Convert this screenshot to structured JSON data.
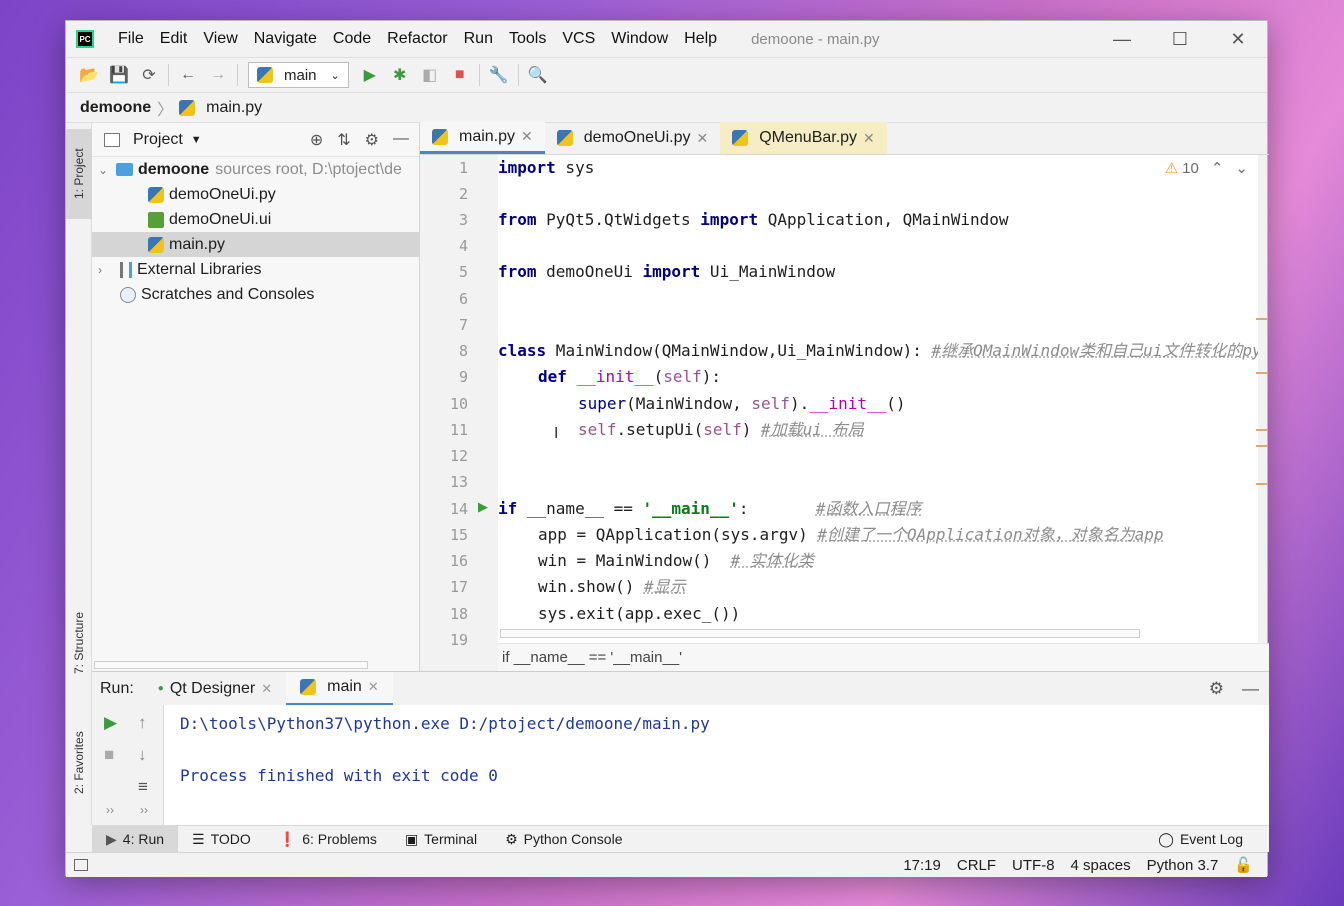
{
  "window": {
    "title": "demoone - main.py",
    "menu": [
      "File",
      "Edit",
      "View",
      "Navigate",
      "Code",
      "Refactor",
      "Run",
      "Tools",
      "VCS",
      "Window",
      "Help"
    ],
    "controls": [
      "—",
      "☐",
      "✕"
    ]
  },
  "toolbar": {
    "run_config": "main"
  },
  "breadcrumb": {
    "project": "demoone",
    "file": "main.py"
  },
  "left_stripe": {
    "project_tab": "1: Project",
    "structure_tab": "7: Structure",
    "favorites_tab": "2: Favorites"
  },
  "project_panel": {
    "title": "Project",
    "root_name": "demoone",
    "root_hint": "sources root,  D:\\ptoject\\de",
    "files": [
      "demoOneUi.py",
      "demoOneUi.ui",
      "main.py"
    ],
    "external_libraries": "External Libraries",
    "scratches": "Scratches and Consoles"
  },
  "editor": {
    "tabs": [
      "main.py",
      "demoOneUi.py",
      "QMenuBar.py"
    ],
    "warnings_count": "10",
    "line_numbers": [
      "1",
      "2",
      "3",
      "4",
      "5",
      "6",
      "7",
      "8",
      "9",
      "10",
      "11",
      "12",
      "13",
      "14",
      "15",
      "16",
      "17",
      "18",
      "19"
    ],
    "footer_breadcrumb": "if __name__ == '__main__'"
  },
  "code": {
    "l1_kw": "import",
    "l1_rest": " sys",
    "l3_kw1": "from",
    "l3_mod": " PyQt5.QtWidgets ",
    "l3_kw2": "import",
    "l3_rest": " QApplication, QMainWindow",
    "l5_kw1": "from",
    "l5_mod": " demoOneUi ",
    "l5_kw2": "import",
    "l5_rest": " Ui_MainWindow",
    "l8_kw": "class",
    "l8_rest": " MainWindow(QMainWindow,Ui_MainWindow): ",
    "l8_cmt": "#继承QMainWindow类和自己ui文件转化的py",
    "l9_kw": "def",
    "l9_sp": " ",
    "l9_fn": "__init__",
    "l9_p1": "(",
    "l9_self": "self",
    "l9_p2": "):",
    "l10_a": "super",
    "l10_b": "(MainWindow, ",
    "l10_self": "self",
    "l10_c": ").",
    "l10_fn": "__init__",
    "l10_d": "()",
    "l11_self": "self",
    "l11_a": ".setupUi(",
    "l11_self2": "self",
    "l11_b": ") ",
    "l11_cmt": "#加载ui 布局",
    "l14_kw": "if",
    "l14_a": " __name__ == ",
    "l14_str": "'__main__'",
    "l14_b": ":       ",
    "l14_cmt": "#函数入口程序",
    "l15_a": "app = QApplication(sys.argv) ",
    "l15_cmt": "#创建了一个QApplication对象，对象名为app",
    "l16_a": "win = MainWindow()  ",
    "l16_cmt": "# 实体化类",
    "l17_a": "win.show() ",
    "l17_cmt": "#显示",
    "l18_a": "sys.exit(app.exec_())"
  },
  "run_panel": {
    "label": "Run:",
    "tabs": [
      "Qt Designer",
      "main"
    ],
    "console_lines": [
      "D:\\tools\\Python37\\python.exe D:/ptoject/demoone/main.py",
      "",
      "Process finished with exit code 0"
    ]
  },
  "toolwindows": {
    "run": "4: Run",
    "todo": "TODO",
    "problems": "6: Problems",
    "terminal": "Terminal",
    "python_console": "Python Console",
    "event_log": "Event Log"
  },
  "status": {
    "position": "17:19",
    "line_sep": "CRLF",
    "encoding": "UTF-8",
    "indent": "4 spaces",
    "interpreter": "Python 3.7"
  }
}
